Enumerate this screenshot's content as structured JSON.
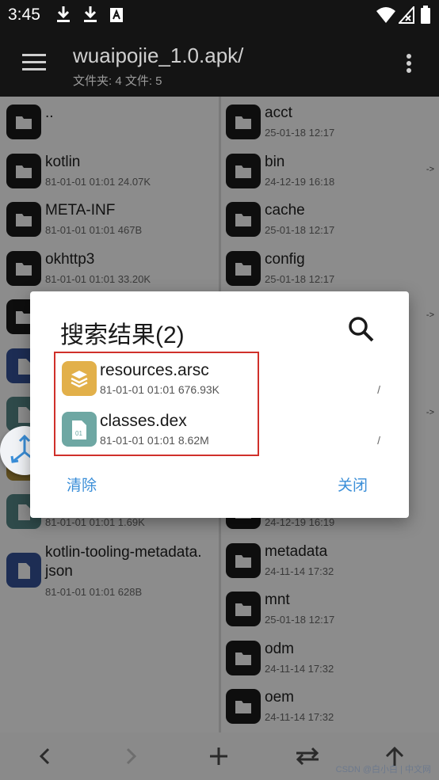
{
  "status": {
    "time": "3:45"
  },
  "appbar": {
    "title": "wuaipojie_1.0.apk/",
    "subtitle": "文件夹: 4  文件: 5"
  },
  "left_pane": [
    {
      "name": "..",
      "meta": "",
      "icon": "folder-icon",
      "style": ""
    },
    {
      "name": "kotlin",
      "meta": "81-01-01 01:01  24.07K",
      "icon": "folder-icon",
      "style": ""
    },
    {
      "name": "META-INF",
      "meta": "81-01-01 01:01  467B",
      "icon": "folder-icon",
      "style": ""
    },
    {
      "name": "okhttp3",
      "meta": "81-01-01 01:01  33.20K",
      "icon": "folder-icon",
      "style": ""
    },
    {
      "name": "",
      "meta": "",
      "icon": "folder-icon",
      "style": ""
    },
    {
      "name": "",
      "meta": "",
      "icon": "code-file-icon",
      "style": "doc"
    },
    {
      "name": "",
      "meta": "",
      "icon": "dex-file-icon",
      "style": "teal"
    },
    {
      "name": "",
      "meta": "",
      "icon": "file-icon",
      "style": "orange"
    },
    {
      "name": "",
      "meta": "81-01-01 01:01  1.69K",
      "icon": "file-icon",
      "style": "teal"
    },
    {
      "name": "kotlin-tooling-metadata.\njson",
      "meta": "81-01-01 01:01  628B",
      "icon": "document-icon",
      "style": "doc"
    }
  ],
  "right_pane": [
    {
      "name": "acct",
      "meta": "25-01-18 12:17",
      "arrow": ""
    },
    {
      "name": "bin",
      "meta": "24-12-19 16:18",
      "arrow": "->"
    },
    {
      "name": "cache",
      "meta": "25-01-18 12:17",
      "arrow": ""
    },
    {
      "name": "config",
      "meta": "25-01-18 12:17",
      "arrow": ""
    },
    {
      "name": "",
      "meta": "",
      "arrow": "->"
    },
    {
      "name": "",
      "meta": "",
      "arrow": ""
    },
    {
      "name": "",
      "meta": "",
      "arrow": "->"
    },
    {
      "name": "",
      "meta": "",
      "arrow": ""
    },
    {
      "name": "",
      "meta": "24-12-19 16:19",
      "arrow": ""
    },
    {
      "name": "metadata",
      "meta": "24-11-14 17:32",
      "arrow": ""
    },
    {
      "name": "mnt",
      "meta": "25-01-18 12:17",
      "arrow": ""
    },
    {
      "name": "odm",
      "meta": "24-11-14 17:32",
      "arrow": ""
    },
    {
      "name": "oem",
      "meta": "24-11-14 17:32",
      "arrow": ""
    }
  ],
  "dialog": {
    "title": "搜索结果(2)",
    "results": [
      {
        "name": "resources.arsc",
        "meta": "81-01-01 01:01  676.93K",
        "path": "/",
        "icon": "layers-icon"
      },
      {
        "name": "classes.dex",
        "meta": "81-01-01 01:01  8.62M",
        "path": "/",
        "icon": "dex-file-icon"
      }
    ],
    "clear_label": "清除",
    "close_label": "关闭"
  },
  "watermark": "CSDN @白小白 | 中文网",
  "colors": {
    "accent": "#3a8ed8",
    "highlight": "#d0302a",
    "bar": "#141414"
  }
}
